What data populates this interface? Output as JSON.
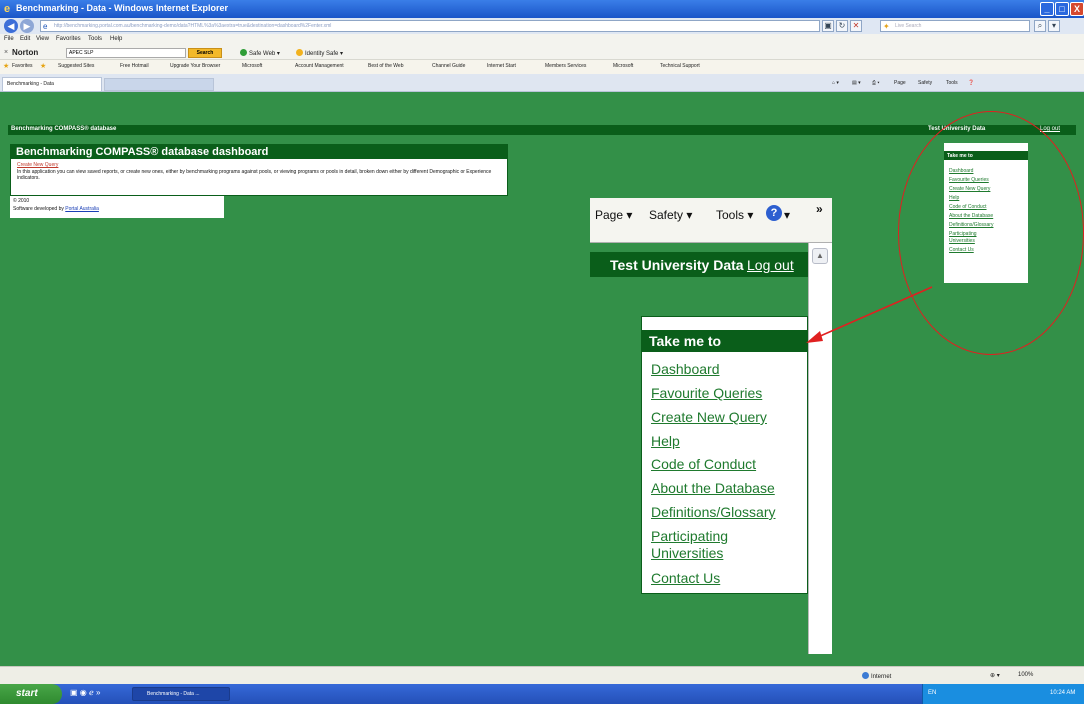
{
  "window": {
    "title": "Benchmarking - Data - Windows Internet Explorer",
    "min_glyph": "_",
    "max_glyph": "□",
    "close_glyph": "X"
  },
  "nav": {
    "url": "http://benchmarking.portal.com.au/benchmarking-demo/data?HTML%3a%3aextra=true&destination=dashboard%2Fenter.xml",
    "search_placeholder": "Live Search"
  },
  "menu": [
    "File",
    "Edit",
    "View",
    "Favorites",
    "Tools",
    "Help"
  ],
  "norton": {
    "brand": "Norton",
    "search_value": "APEC SLP",
    "search_button": "Search",
    "safe_web": "Safe Web",
    "identity_safe": "Identity Safe"
  },
  "favorites": {
    "label": "Favorites",
    "items": [
      "Suggested Sites",
      "Free Hotmail",
      "Upgrade Your Browser",
      "Microsoft",
      "Account Management",
      "Best of the Web",
      "Channel Guide",
      "Internet Start",
      "Members Services",
      "Microsoft",
      "Technical Support"
    ]
  },
  "tabs": {
    "active": "Benchmarking - Data",
    "commands": [
      "Page",
      "Safety",
      "Tools"
    ]
  },
  "site": {
    "header_title": "Benchmarking COMPASS® database",
    "user_name": "Test University Data",
    "logout": "Log out"
  },
  "dashboard": {
    "title": "Benchmarking COMPASS® database dashboard",
    "create_link": "Create New Query",
    "description": "In this application you can view saved reports, or create new ones, either by benchmarking programs against pools, or viewing programs or pools in detail, broken down either by different Demographic or Experience indicators.",
    "copyright": "© 2010",
    "developed_by": "Software developed by",
    "developer": "Portal Australia"
  },
  "take_me_to": {
    "title": "Take me to",
    "links": [
      "Dashboard",
      "Favourite Queries",
      "Create New Query",
      "Help",
      "Code of Conduct",
      "About the Database",
      "Definitions/Glossary",
      "Participating Universities",
      "Contact Us"
    ],
    "participating_line1": "Participating",
    "participating_line2": "Universities"
  },
  "inset": {
    "page": "Page",
    "safety": "Safety",
    "tools": "Tools",
    "overflow": "»"
  },
  "status": {
    "zone": "Internet",
    "zoom": "100%"
  },
  "taskbar": {
    "start": "start",
    "task": "Benchmarking - Data ...",
    "lang": "EN",
    "clock": "10:24 AM"
  },
  "colors": {
    "page_green": "#339048",
    "dark_green": "#0a5e1a",
    "link_green": "#1f7a2e",
    "annotation_red": "#e02020"
  }
}
